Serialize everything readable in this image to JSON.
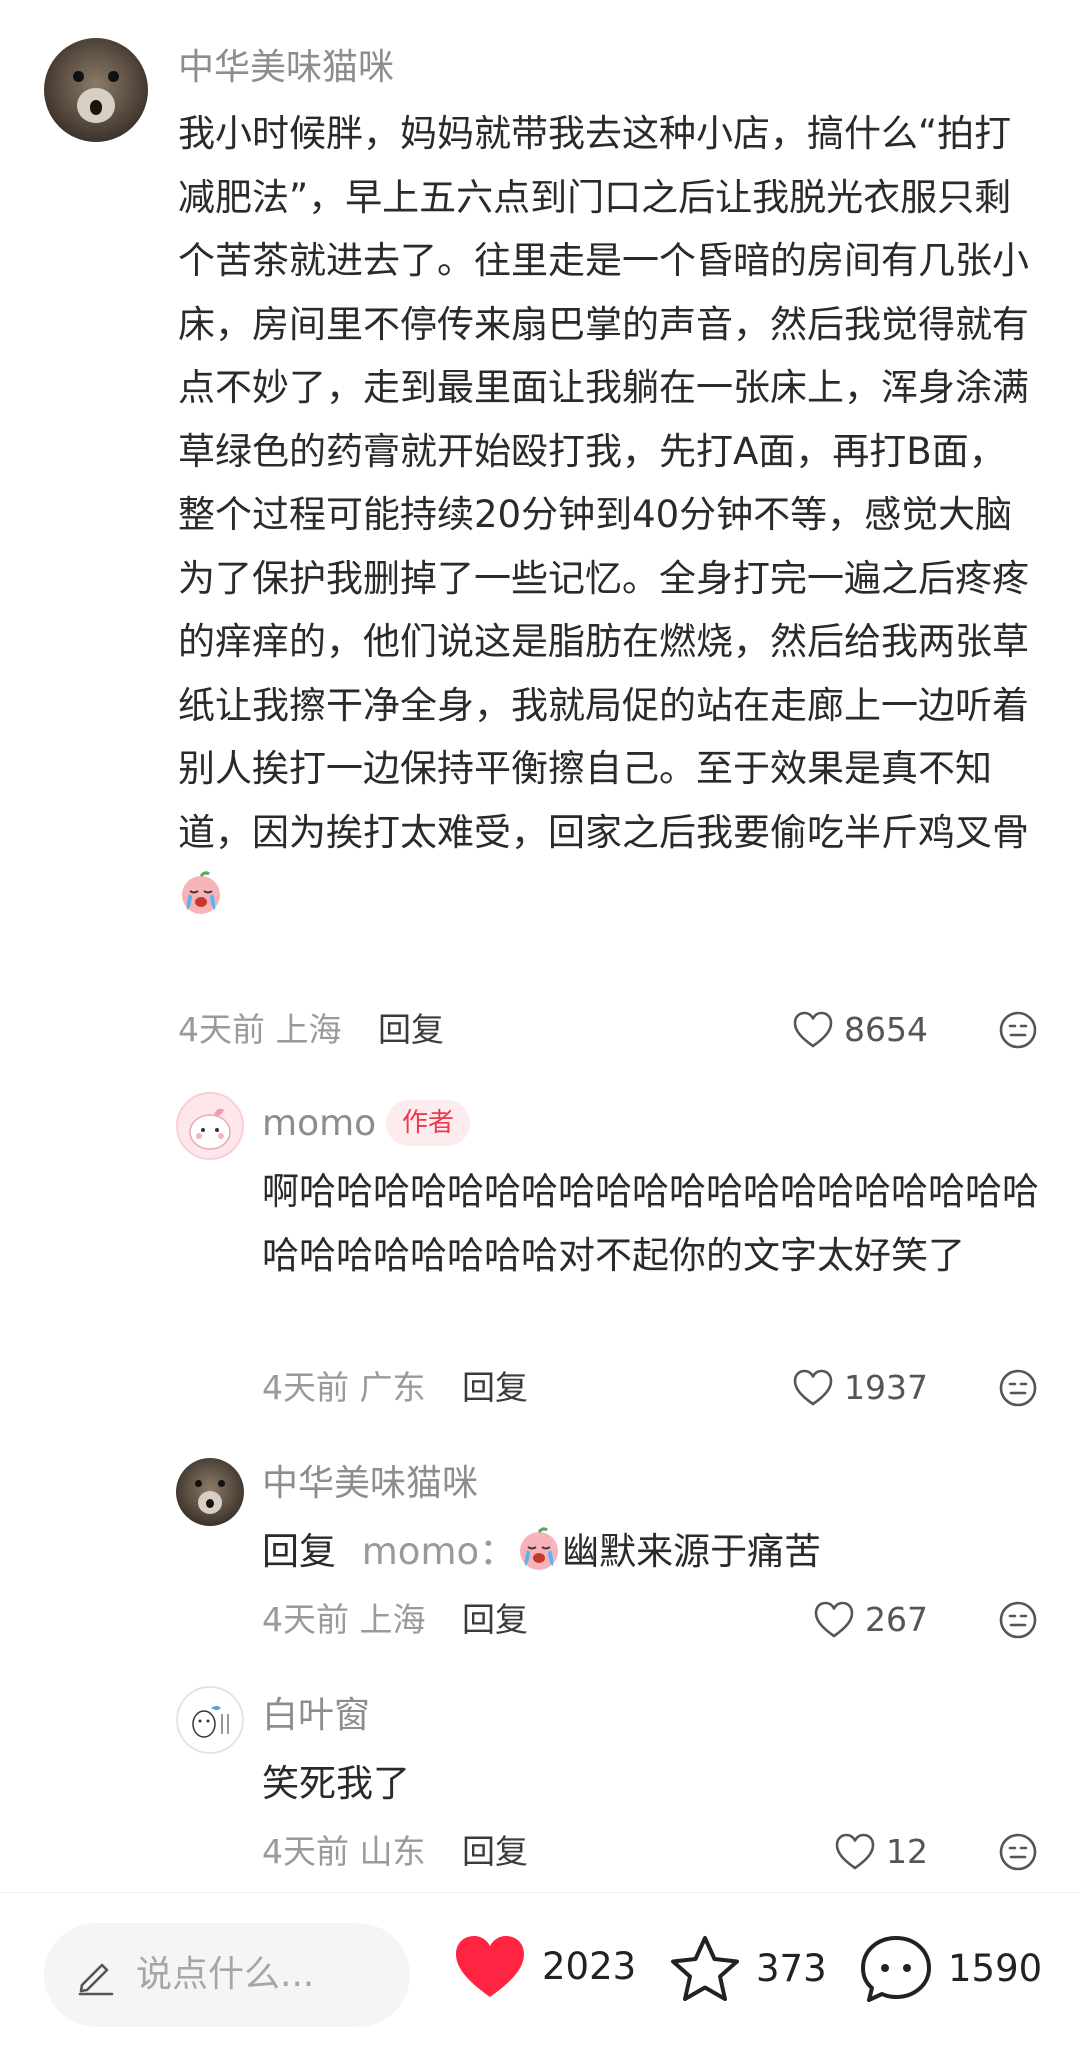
{
  "comments": [
    {
      "username": "中华美味猫咪",
      "text": "我小时候胖，妈妈就带我去这种小店，搞什么“拍打减肥法”，早上五六点到门口之后让我脱光衣服只剩个苦茶就进去了。往里走是一个昏暗的房间有几张小床，房间里不停传来扇巴掌的声音，然后我觉得就有点不妙了，走到最里面让我躺在一张床上，浑身涂满草绿色的药膏就开始殴打我，先打A面，再打B面，整个过程可能持续20分钟到40分钟不等，感觉大脑为了保护我删掉了一些记忆。全身打完一遍之后疼疼的痒痒的，他们说这是脂肪在燃烧，然后给我两张草纸让我擦干净全身，我就局促的站在走廊上一边听着别人挨打一边保持平衡擦自己。至于效果是真不知道，因为挨打太难受，回家之后我要偷吃半斤鸡叉骨",
      "time": "4天前",
      "location": "上海",
      "reply_label": "回复",
      "likes": "8654"
    },
    {
      "username": "momo",
      "badge": "作者",
      "text": "啊哈哈哈哈哈哈哈哈哈哈哈哈哈哈哈哈哈哈哈哈哈哈哈哈哈哈哈哈对不起你的文字太好笑了",
      "time": "4天前",
      "location": "广东",
      "reply_label": "回复",
      "likes": "1937"
    },
    {
      "username": "中华美味猫咪",
      "reply_prefix": "回复",
      "reply_to": "momo：",
      "text": "幽默来源于痛苦",
      "time": "4天前",
      "location": "上海",
      "reply_label": "回复",
      "likes": "267"
    },
    {
      "username": "白叶窗",
      "text": "笑死我了",
      "time": "4天前",
      "location": "山东",
      "reply_label": "回复",
      "likes": "12"
    }
  ],
  "bottom_bar": {
    "input_placeholder": "说点什么...",
    "like_count": "2023",
    "collect_count": "373",
    "comment_count": "1590"
  },
  "colors": {
    "accent_red": "#ff2442",
    "badge_bg": "#fdecee",
    "badge_text": "#ec3a4f"
  },
  "icons": [
    "heart-outline-icon",
    "reaction-face-icon",
    "pencil-icon",
    "heart-filled-icon",
    "star-icon",
    "chat-bubble-icon",
    "crying-emoji-icon"
  ]
}
